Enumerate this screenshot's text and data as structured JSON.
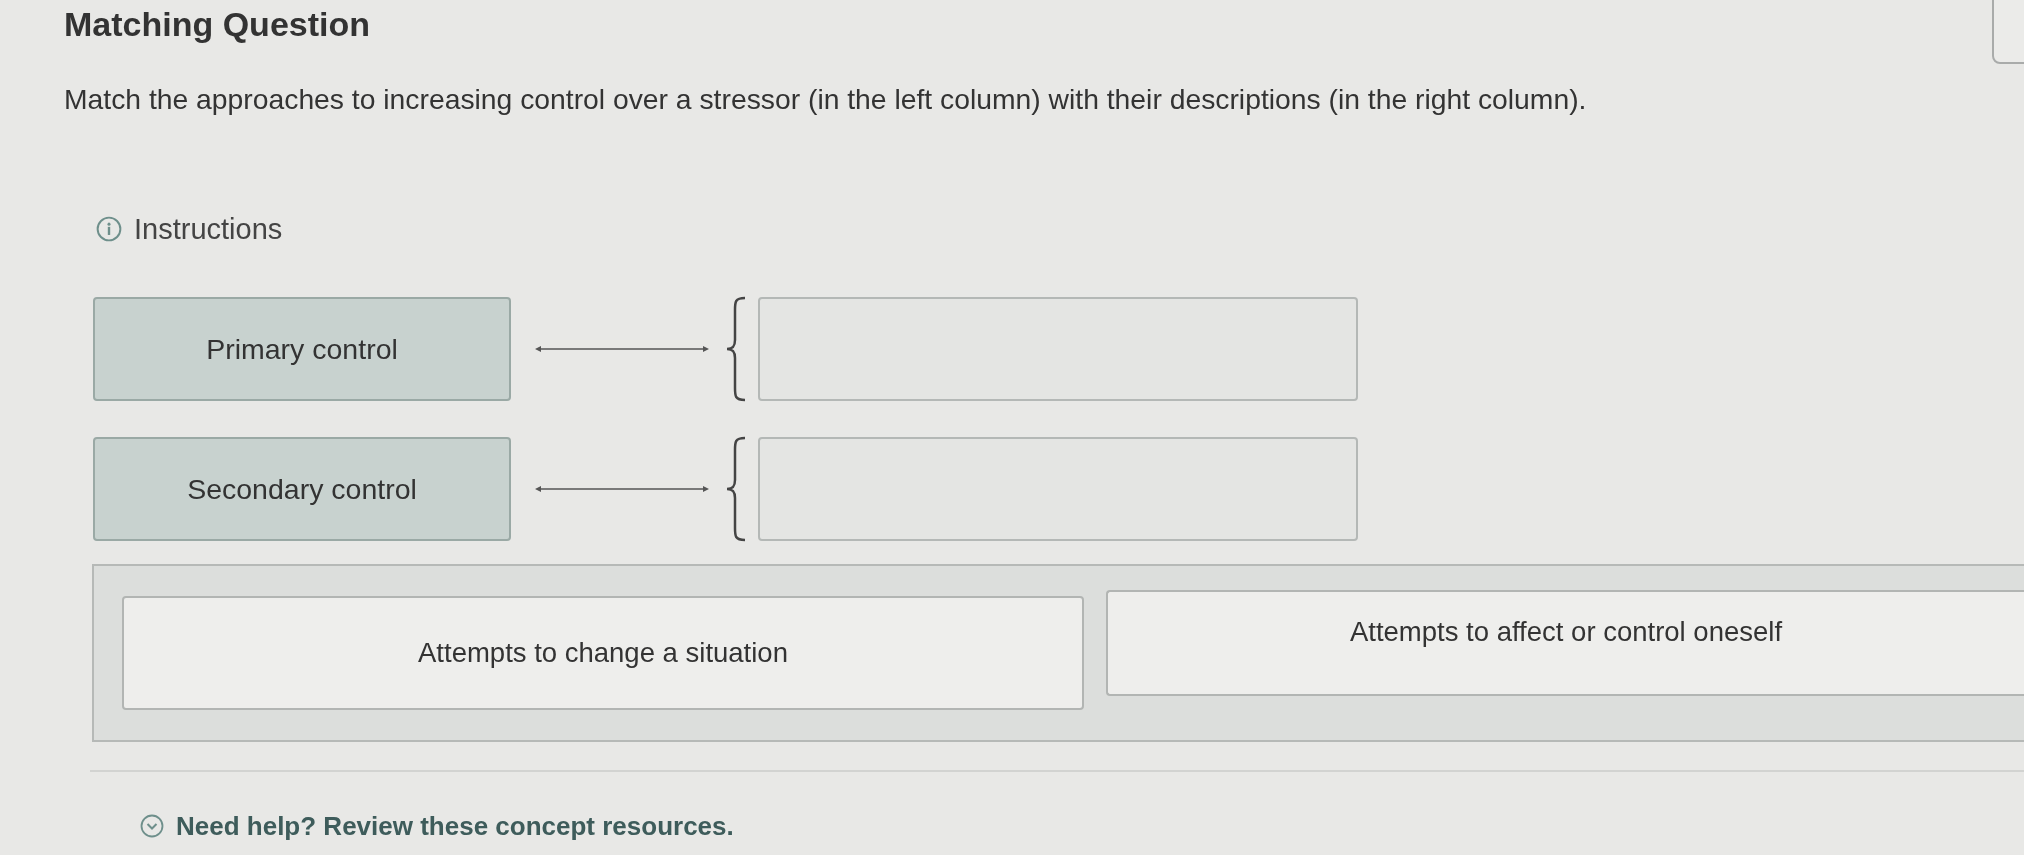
{
  "title": "Matching Question",
  "prompt": "Match the approaches to increasing control over a stressor (in the left column) with their descriptions (in the right column).",
  "instructions": {
    "label": "Instructions"
  },
  "pairs": [
    {
      "term": "Primary control"
    },
    {
      "term": "Secondary control"
    }
  ],
  "answer_bank": [
    {
      "text": "Attempts to change a situation"
    },
    {
      "text": "Attempts to affect or control oneself"
    }
  ],
  "help": {
    "label": "Need help? Review these concept resources.",
    "expanded": false
  }
}
